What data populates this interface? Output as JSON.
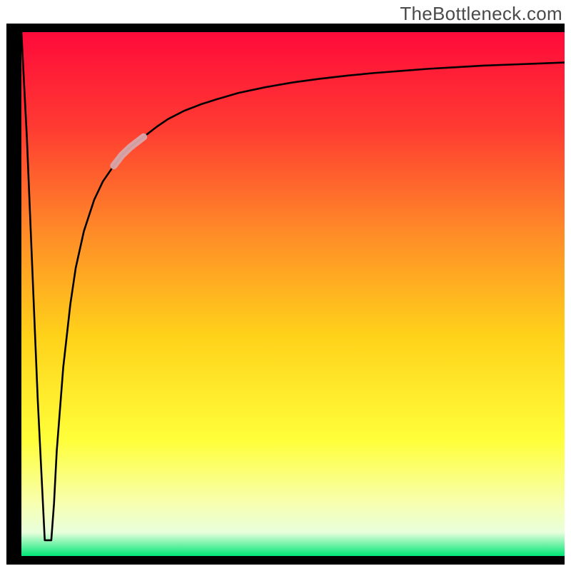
{
  "watermark": "TheBottleneck.com",
  "chart_data": {
    "type": "line",
    "title": "",
    "xlabel": "",
    "ylabel": "",
    "xlim": [
      0,
      100
    ],
    "ylim": [
      0,
      100
    ],
    "grid": false,
    "series": [
      {
        "name": "bottleneck-curve",
        "x": [
          0.0,
          1.0,
          2.0,
          3.0,
          4.3,
          5.5,
          6.0,
          6.5,
          7.7,
          9.0,
          10.0,
          11.5,
          13.4,
          15.0,
          17.0,
          18.5,
          20.0,
          22.5,
          25.0,
          27.0,
          30.0,
          33.0,
          36.0,
          40.0,
          45.0,
          50.0,
          55.0,
          60.0,
          65.0,
          70.0,
          75.0,
          80.0,
          85.0,
          90.0,
          95.0,
          100.0
        ],
        "values": [
          100.0,
          80.0,
          55.0,
          30.0,
          3.0,
          3.0,
          10.0,
          20.0,
          36.0,
          48.0,
          55.0,
          62.0,
          68.0,
          71.5,
          74.5,
          76.5,
          78.0,
          80.0,
          82.0,
          83.4,
          85.0,
          86.2,
          87.2,
          88.4,
          89.5,
          90.4,
          91.1,
          91.7,
          92.2,
          92.6,
          93.0,
          93.3,
          93.6,
          93.8,
          94.0,
          94.2
        ]
      }
    ],
    "highlight_segment": {
      "x_range": [
        17.0,
        22.5
      ],
      "color": "#d9a6ab"
    },
    "background_gradient": {
      "stops": [
        {
          "offset": 0.0,
          "color": "#ff0a3a"
        },
        {
          "offset": 0.18,
          "color": "#ff3a32"
        },
        {
          "offset": 0.38,
          "color": "#ff8a28"
        },
        {
          "offset": 0.58,
          "color": "#ffd21a"
        },
        {
          "offset": 0.78,
          "color": "#ffff3a"
        },
        {
          "offset": 0.9,
          "color": "#f7ffb0"
        },
        {
          "offset": 0.955,
          "color": "#e8ffdc"
        },
        {
          "offset": 1.0,
          "color": "#00e676"
        }
      ]
    }
  }
}
